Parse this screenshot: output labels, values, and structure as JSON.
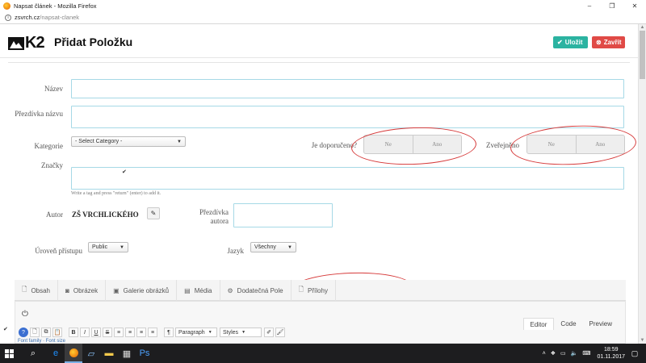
{
  "window": {
    "title": "Napsat článek - Mozilla Firefox",
    "controls": [
      "–",
      "❐",
      "✕"
    ]
  },
  "address": {
    "host": "zsvrch.cz",
    "path": "/napsat-clanek"
  },
  "header": {
    "logo_text": "K2",
    "page_title": "Přidat Položku",
    "save_label": "Uložit",
    "close_label": "Zavřít",
    "save_color": "#2bb3a1",
    "close_color": "#e04a46"
  },
  "form": {
    "title_label": "Název",
    "alias_label": "Přezdívka názvu",
    "category_label": "Kategorie",
    "category_value": "- Select Category -",
    "featured_label": "Je doporučeno?",
    "featured_no": "Ne",
    "featured_yes": "Ano",
    "published_label": "Zveřejněno",
    "published_no": "Ne",
    "published_yes": "Ano",
    "tags_label": "Značky",
    "tags_hint": "Write a tag and press \"return\" (enter) to add it.",
    "author_label": "Autor",
    "author_name": "ZŠ VRCHLICKÉHO",
    "author_alias_label": "Přezdívka autora",
    "access_label": "Úroveň přístupu",
    "access_value": "Public",
    "language_label": "Jazyk",
    "language_value": "Všechny"
  },
  "tabs": [
    {
      "label": "Obsah",
      "icon": "document-icon"
    },
    {
      "label": "Obrázek",
      "icon": "camera-icon"
    },
    {
      "label": "Galerie obrázků",
      "icon": "gallery-icon"
    },
    {
      "label": "Média",
      "icon": "film-icon"
    },
    {
      "label": "Dodatečná Pole",
      "icon": "gear-icon"
    },
    {
      "label": "Přílohy",
      "icon": "attachment-icon"
    }
  ],
  "editor": {
    "tabs": [
      "Editor",
      "Code",
      "Preview"
    ],
    "active_tab": "Editor",
    "paragraph_format": "Paragraph",
    "styles_label": "Styles",
    "toolbar_cutoff_text": "Font family · Font size"
  },
  "taskbar": {
    "time": "18:59",
    "date": "01.11.2017"
  },
  "annotation_color": "#d63a3a"
}
